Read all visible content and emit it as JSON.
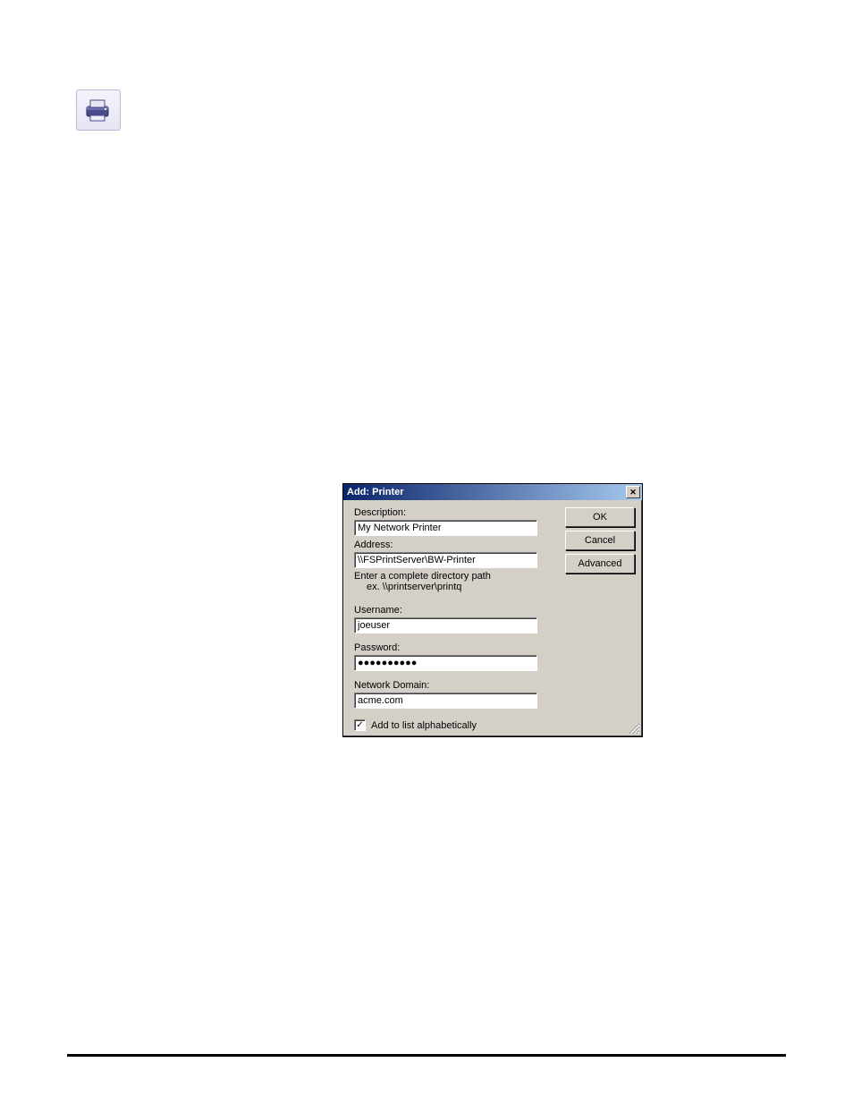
{
  "toolbar_icon": "printer-icon",
  "dialog": {
    "title": "Add: Printer",
    "close_glyph": "✕",
    "description_label": "Description:",
    "description_value": "My Network Printer",
    "address_label": "Address:",
    "address_value": "\\\\FSPrintServer\\BW-Printer",
    "hint_line1": "Enter a complete directory path",
    "hint_line2": "ex. \\\\printserver\\printq",
    "username_label": "Username:",
    "username_value": "joeuser",
    "password_label": "Password:",
    "password_value": "●●●●●●●●●●",
    "domain_label": "Network Domain:",
    "domain_value": "acme.com",
    "checkbox_label": "Add to list alphabetically",
    "checkbox_checked_glyph": "✓",
    "buttons": {
      "ok": "OK",
      "cancel": "Cancel",
      "advanced": "Advanced"
    }
  }
}
